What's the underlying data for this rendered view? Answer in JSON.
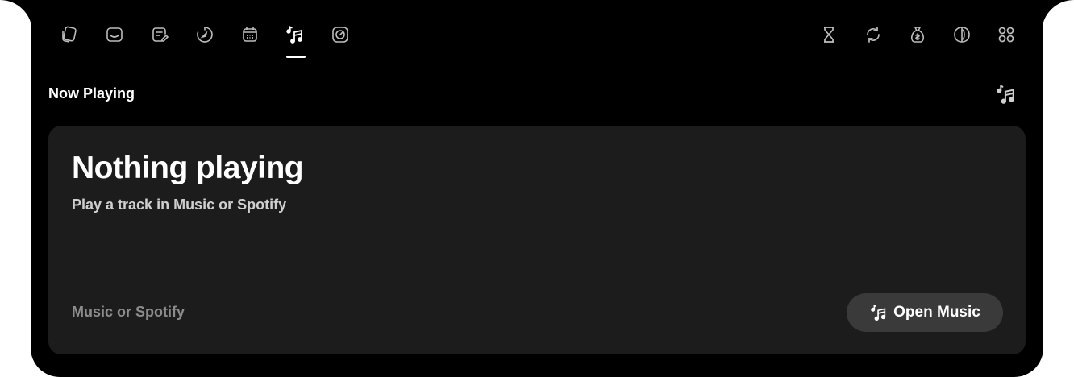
{
  "tabs_left": [
    {
      "icon": "cards-icon"
    },
    {
      "icon": "tray-icon"
    },
    {
      "icon": "note-edit-icon"
    },
    {
      "icon": "timer-icon"
    },
    {
      "icon": "calendar-icon"
    },
    {
      "icon": "music-notes-icon",
      "active": true
    },
    {
      "icon": "gauge-icon"
    }
  ],
  "tabs_right": [
    {
      "icon": "hourglass-icon"
    },
    {
      "icon": "refresh-icon"
    },
    {
      "icon": "money-bag-icon"
    },
    {
      "icon": "contrast-icon"
    },
    {
      "icon": "grid-icon"
    }
  ],
  "section": {
    "title": "Now Playing",
    "icon": "music-notes-icon"
  },
  "player": {
    "title": "Nothing playing",
    "subtitle": "Play a track in Music or Spotify",
    "source": "Music or Spotify",
    "open_button_label": "Open Music",
    "open_button_icon": "music-notes-icon"
  },
  "colors": {
    "background": "#000000",
    "card": "#1c1c1c",
    "button": "#3a3a3a",
    "text_primary": "#ffffff",
    "text_secondary": "#cfcfcf",
    "text_muted": "#8c8c8c"
  }
}
